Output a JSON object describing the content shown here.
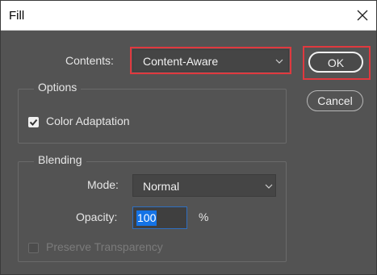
{
  "dialog": {
    "title": "Fill"
  },
  "contents": {
    "label": "Contents:",
    "value": "Content-Aware"
  },
  "buttons": {
    "ok": "OK",
    "cancel": "Cancel"
  },
  "options": {
    "legend": "Options",
    "color_adaptation": {
      "label": "Color Adaptation",
      "checked": true
    }
  },
  "blending": {
    "legend": "Blending",
    "mode": {
      "label": "Mode:",
      "value": "Normal"
    },
    "opacity": {
      "label": "Opacity:",
      "value": "100",
      "unit": "%"
    },
    "preserve_transparency": {
      "label": "Preserve Transparency",
      "checked": false,
      "enabled": false
    }
  },
  "colors": {
    "highlight": "#e0393f",
    "dialog_bg": "#535353",
    "selection": "#1473e6"
  }
}
